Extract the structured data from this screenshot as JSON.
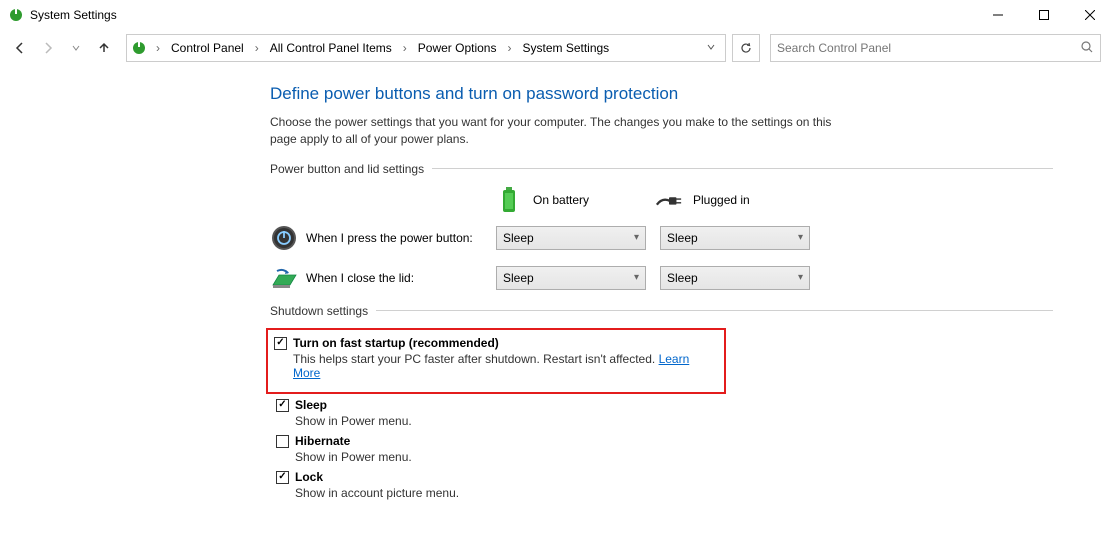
{
  "window": {
    "title": "System Settings"
  },
  "breadcrumb": {
    "items": [
      "Control Panel",
      "All Control Panel Items",
      "Power Options",
      "System Settings"
    ]
  },
  "search": {
    "placeholder": "Search Control Panel"
  },
  "page": {
    "title": "Define power buttons and turn on password protection",
    "description": "Choose the power settings that you want for your computer. The changes you make to the settings on this page apply to all of your power plans."
  },
  "power_section": {
    "header": "Power button and lid settings",
    "col_battery": "On battery",
    "col_plugged": "Plugged in",
    "rows": [
      {
        "label": "When I press the power button:",
        "battery": "Sleep",
        "plugged": "Sleep"
      },
      {
        "label": "When I close the lid:",
        "battery": "Sleep",
        "plugged": "Sleep"
      }
    ]
  },
  "shutdown_section": {
    "header": "Shutdown settings",
    "items": [
      {
        "label": "Turn on fast startup (recommended)",
        "checked": true,
        "desc": "This helps start your PC faster after shutdown. Restart isn't affected.",
        "link": "Learn More",
        "highlight": true
      },
      {
        "label": "Sleep",
        "checked": true,
        "desc": "Show in Power menu."
      },
      {
        "label": "Hibernate",
        "checked": false,
        "desc": "Show in Power menu."
      },
      {
        "label": "Lock",
        "checked": true,
        "desc": "Show in account picture menu."
      }
    ]
  }
}
